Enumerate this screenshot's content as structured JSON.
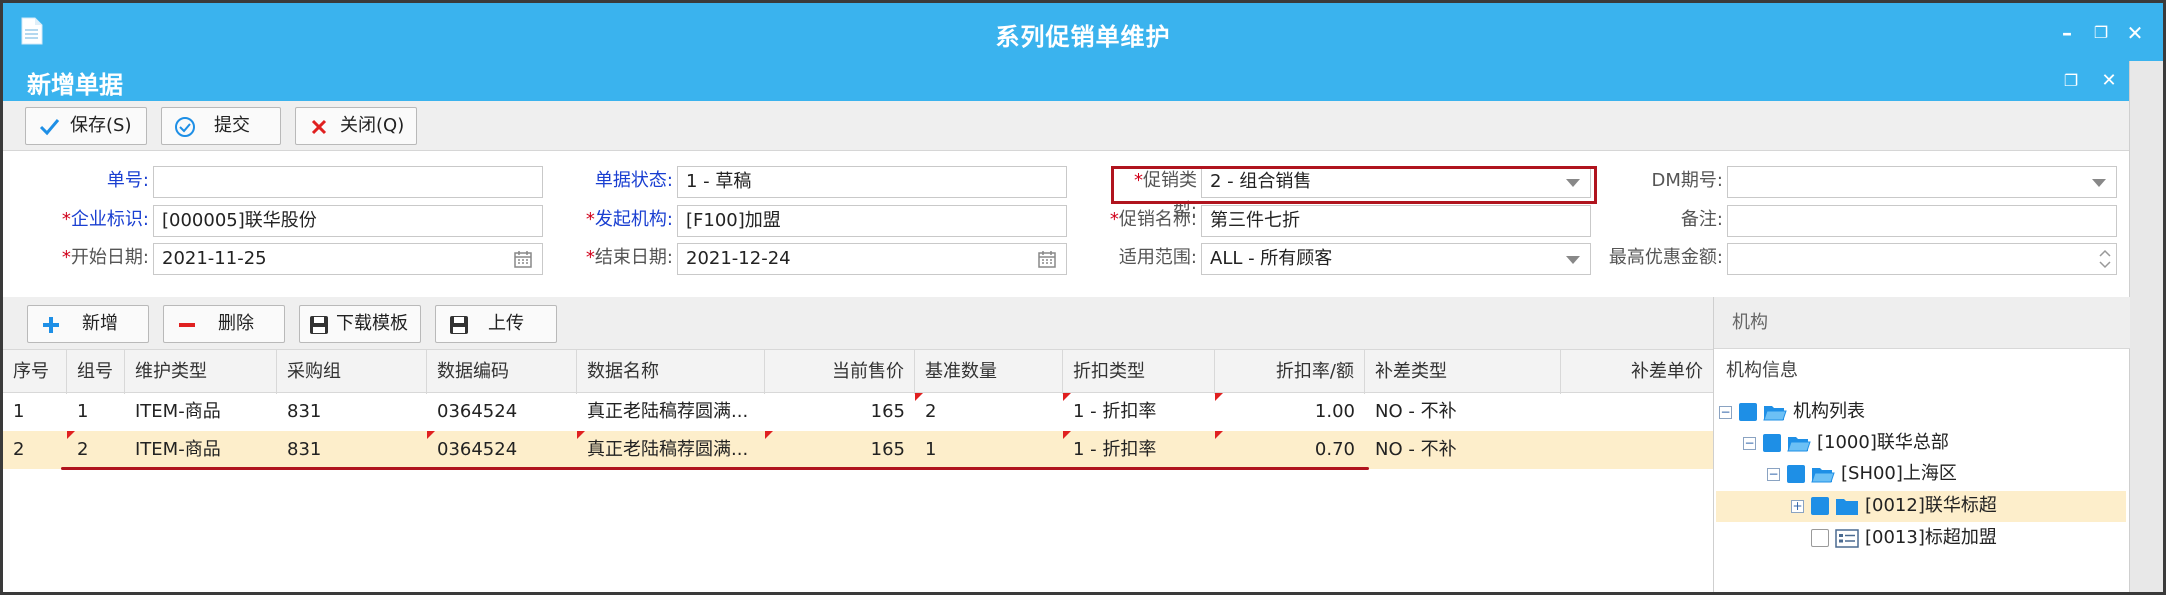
{
  "window": {
    "title": "系列促销单维护"
  },
  "panel": {
    "title": "新增单据"
  },
  "toolbar": {
    "save": "保存(S)",
    "submit": "提交",
    "close": "关闭(Q)"
  },
  "form": {
    "order_no": {
      "label": "单号:",
      "value": ""
    },
    "status": {
      "label": "单据状态:",
      "value": "1 - 草稿"
    },
    "promo_type": {
      "label": "促销类型:",
      "value": "2 - 组合销售"
    },
    "dm_no": {
      "label": "DM期号:",
      "value": ""
    },
    "company": {
      "label": "企业标识:",
      "value": "[000005]联华股份"
    },
    "org": {
      "label": "发起机构:",
      "value": "[F100]加盟"
    },
    "promo_name": {
      "label": "促销名称:",
      "value": "第三件七折"
    },
    "remark": {
      "label": "备注:",
      "value": ""
    },
    "start_date": {
      "label": "开始日期:",
      "value": "2021-11-25"
    },
    "end_date": {
      "label": "结束日期:",
      "value": "2021-12-24"
    },
    "scope": {
      "label": "适用范围:",
      "value": "ALL - 所有顾客"
    },
    "max_discount": {
      "label": "最高优惠金额:",
      "value": ""
    },
    "required_mark": "*"
  },
  "detail_toolbar": {
    "add": "新增",
    "delete": "删除",
    "download": "下载模板",
    "upload": "上传"
  },
  "grid": {
    "headers": [
      "序号",
      "组号",
      "维护类型",
      "采购组",
      "数据编码",
      "数据名称",
      "当前售价",
      "基准数量",
      "折扣类型",
      "折扣率/额",
      "补差类型",
      "补差单价"
    ],
    "rows": [
      [
        "1",
        "1",
        "ITEM-商品",
        "831",
        "0364524",
        "真正老陆稿荐圆满...",
        "165",
        "2",
        "1 - 折扣率",
        "1.00",
        "NO - 不补",
        ""
      ],
      [
        "2",
        "2",
        "ITEM-商品",
        "831",
        "0364524",
        "真正老陆稿荐圆满...",
        "165",
        "1",
        "1 - 折扣率",
        "0.70",
        "NO - 不补",
        ""
      ]
    ],
    "selected_row": 1
  },
  "org_panel": {
    "header": "机构",
    "subheader": "机构信息",
    "tree": [
      {
        "label": "机构列表"
      },
      {
        "label": "[1000]联华总部"
      },
      {
        "label": "[SH00]上海区"
      },
      {
        "label": "[0012]联华标超"
      },
      {
        "label": "[0013]标超加盟"
      }
    ]
  },
  "colors": {
    "title_bar": "#3ab3ee",
    "highlight_row": "#fdeecb",
    "annotation_red": "#b0141e",
    "label_blue": "#1a3fd1"
  }
}
